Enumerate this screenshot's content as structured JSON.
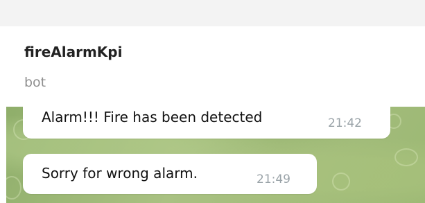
{
  "chat": {
    "title": "fireAlarmKpi",
    "subtitle": "bot"
  },
  "messages": [
    {
      "text": "Alarm!!! Fire has been detected",
      "time": "21:42"
    },
    {
      "text": "Sorry for wrong alarm.",
      "time": "21:49"
    }
  ],
  "colors": {
    "header_bg": "#ffffff",
    "top_strip": "#f3f3f3",
    "chat_background": "#9fb97a",
    "bubble_bg": "#ffffff",
    "time_text": "#9aa3a8",
    "subtitle_text": "#8f8f8f"
  }
}
